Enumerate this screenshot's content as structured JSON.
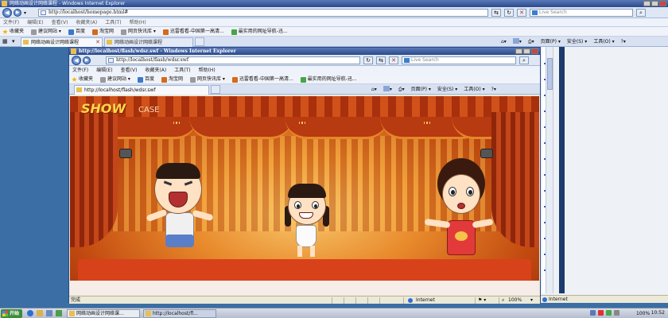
{
  "outer": {
    "title": "网络动画设计网络课程 - Windows Internet Explorer",
    "url": "http://localhost/homepage.html#",
    "search_placeholder": "Live Search",
    "menu": [
      "文件(F)",
      "编辑(E)",
      "查看(V)",
      "收藏夹(A)",
      "工具(T)",
      "帮助(H)"
    ],
    "favorites_label": "收藏夹",
    "favorites": [
      "建议网站 ▾",
      "百度",
      "淘宝网",
      "网页快讯库 ▾",
      "迅雷看看-中国第一高清...",
      "最实用的网址导航-迅..."
    ],
    "tabs": [
      "网络动画设计网络课程",
      "网络动画设计网络课程"
    ],
    "tools": [
      "页面(P) ▾",
      "安全(S) ▾",
      "工具(O) ▾"
    ],
    "status_zone": "Internet"
  },
  "inner": {
    "title": "http://localhost/flash/wdsr.swf - Windows Internet Explorer",
    "url": "http://localhost/flash/wdsr.swf",
    "search_placeholder": "Live Search",
    "menu": [
      "文件(F)",
      "编辑(E)",
      "查看(V)",
      "收藏夹(A)",
      "工具(T)",
      "帮助(H)"
    ],
    "favorites_label": "收藏夹",
    "favorites": [
      "建议网站 ▾",
      "百度",
      "淘宝网",
      "网页快讯库 ▾",
      "迅雷看看-中国第一高清...",
      "最实用的网址导航-迅..."
    ],
    "tab": "http://localhost/flash/wdsr.swf",
    "tools": [
      "页面(P) ▾",
      "安全(S) ▾",
      "工具(O) ▾"
    ],
    "status_left": "完成",
    "status_zone": "Internet",
    "zoom": "100%"
  },
  "stage": {
    "logo_show": "SHOW",
    "logo_case": "CASE"
  },
  "taskbar": {
    "start": "开始",
    "tasks": [
      "网络动画设计网络课...",
      "http://localhost/fl..."
    ],
    "zoom": "100%",
    "clock": "10:52"
  }
}
